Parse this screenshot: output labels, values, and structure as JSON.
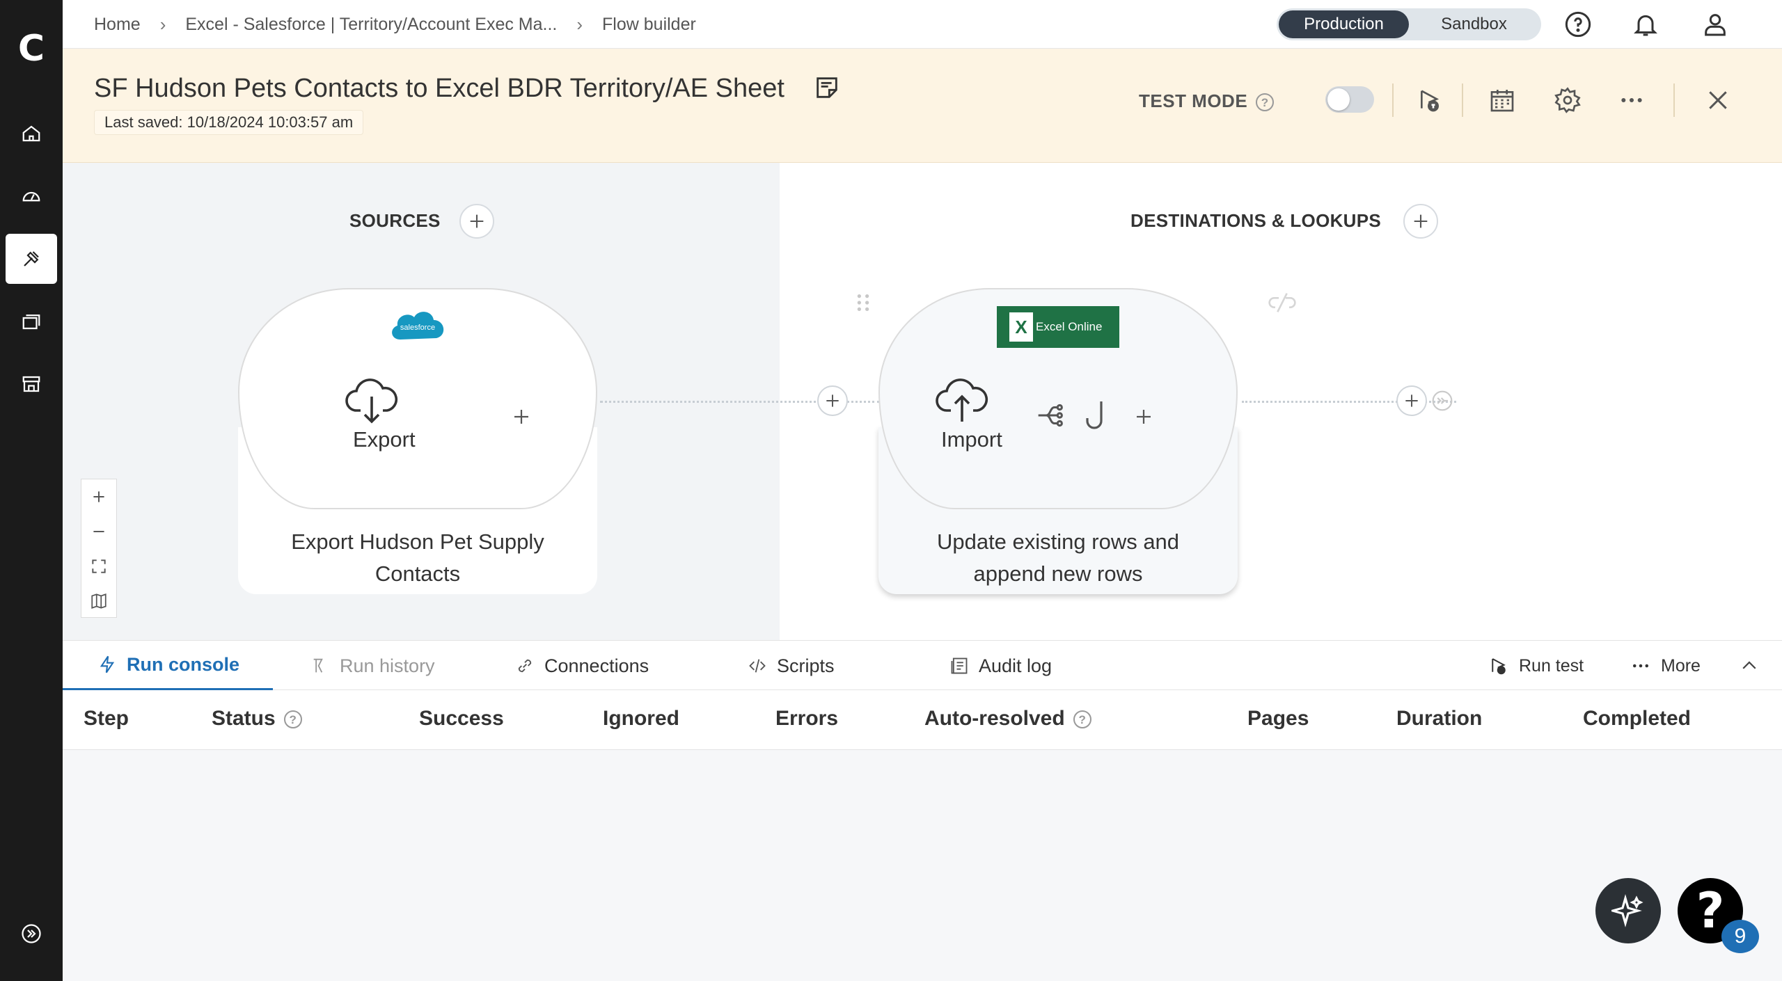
{
  "rail": {
    "logo": "C",
    "items": [
      "home-icon",
      "dashboard-icon",
      "tools-icon",
      "resources-icon",
      "marketplace-icon"
    ],
    "active": 2,
    "expand_icon": "expand-icon"
  },
  "breadcrumbs": [
    "Home",
    "Excel - Salesforce | Territory/Account Exec Ma...",
    "Flow builder"
  ],
  "environment": {
    "production": "Production",
    "sandbox": "Sandbox",
    "active": "Production"
  },
  "flow": {
    "title": "SF Hudson Pets Contacts to Excel BDR Territory/AE Sheet",
    "last_saved": "Last saved: 10/18/2024 10:03:57 am",
    "test_mode_label": "TEST MODE",
    "test_mode_on": false
  },
  "canvas": {
    "sources_title": "SOURCES",
    "destinations_title": "DESTINATIONS & LOOKUPS",
    "source_step": {
      "app": "salesforce",
      "action": "Export",
      "description_line1": "Export Hudson Pet Supply",
      "description_line2": "Contacts"
    },
    "destination_step": {
      "app": "Excel Online",
      "action": "Import",
      "description_line1": "Update existing rows and",
      "description_line2": "append new rows"
    }
  },
  "console": {
    "tabs": [
      {
        "label": "Run console",
        "icon": "lightning-icon",
        "active": true
      },
      {
        "label": "Run history",
        "icon": "history-icon",
        "active": false
      },
      {
        "label": "Connections",
        "icon": "link-icon",
        "active": false
      },
      {
        "label": "Scripts",
        "icon": "code-icon",
        "active": false
      },
      {
        "label": "Audit log",
        "icon": "audit-icon",
        "active": false
      }
    ],
    "run_test": "Run test",
    "more": "More",
    "columns": [
      "Step",
      "Status",
      "Success",
      "Ignored",
      "Errors",
      "Auto-resolved",
      "Pages",
      "Duration",
      "Completed"
    ]
  },
  "help_badge_count": "9",
  "colors": {
    "accent": "#1f6fb5",
    "rail": "#1b1b1b",
    "header_bg": "#fdf4e3",
    "excel_green": "#1f7245",
    "salesforce_blue": "#1798c1"
  }
}
